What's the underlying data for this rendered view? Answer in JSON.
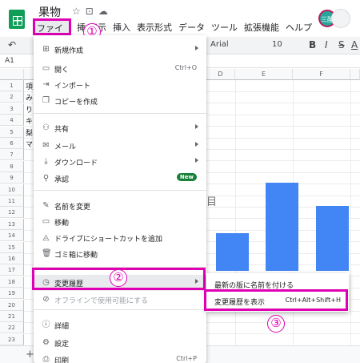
{
  "app": {
    "doc_title": "果物",
    "title_icons": [
      "star-icon",
      "move-folder-icon",
      "cloud-status-icon"
    ],
    "avatar_label": "三酸",
    "menubar": [
      "ファイル",
      "挿",
      "表示",
      "挿入",
      "表示形式",
      "データ",
      "ツール",
      "拡張機能",
      "ヘルプ"
    ]
  },
  "toolbar": {
    "font": "Arial",
    "size": "10",
    "bold": "B",
    "italic": "I",
    "strike": "S",
    "text_color": "A"
  },
  "formula": {
    "namebox": "A1"
  },
  "grid": {
    "columns": [
      "D",
      "E",
      "F"
    ],
    "rows": [
      "1",
      "2",
      "3",
      "4",
      "5",
      "6",
      "7",
      "8",
      "9",
      "10",
      "11",
      "12",
      "13",
      "14",
      "15",
      "16",
      "17",
      "18",
      "19",
      "20",
      "21",
      "22",
      "23"
    ],
    "cells_a": [
      "項",
      "み",
      "り",
      "キ",
      "梨",
      "マ"
    ],
    "chart_title_fragment": "目",
    "add_sheet": "+"
  },
  "chart_data": {
    "type": "bar",
    "categories": [
      "",
      "",
      ""
    ],
    "values": [
      42,
      98,
      72
    ],
    "ylim": [
      0,
      100
    ],
    "title": "",
    "xlabel": "",
    "ylabel": ""
  },
  "menu": {
    "items": [
      {
        "icon": "add-sheet-icon",
        "label": "新規作成",
        "arrow": true
      },
      {
        "icon": "folder-open-icon",
        "label": "開く",
        "shortcut": "Ctrl+O"
      },
      {
        "icon": "import-icon",
        "label": "インポート"
      },
      {
        "icon": "copy-icon",
        "label": "コピーを作成"
      },
      {
        "icon": "share-icon",
        "label": "共有",
        "arrow": true
      },
      {
        "icon": "email-icon",
        "label": "メール",
        "arrow": true
      },
      {
        "icon": "download-icon",
        "label": "ダウンロード",
        "arrow": true
      },
      {
        "icon": "approval-icon",
        "label": "承認",
        "badge": "New"
      },
      {
        "icon": "rename-icon",
        "label": "名前を変更"
      },
      {
        "icon": "move-icon",
        "label": "移動"
      },
      {
        "icon": "drive-shortcut-icon",
        "label": "ドライブにショートカットを追加"
      },
      {
        "icon": "trash-icon",
        "label": "ゴミ箱に移動"
      },
      {
        "icon": "history-icon",
        "label": "変更履歴",
        "arrow": true
      },
      {
        "icon": "offline-icon",
        "label": "オフラインで使用可能にする"
      },
      {
        "icon": "info-icon",
        "label": "詳細"
      },
      {
        "icon": "settings-icon",
        "label": "設定"
      },
      {
        "icon": "print-icon",
        "label": "印刷",
        "shortcut": "Ctrl+P"
      }
    ]
  },
  "submenu": {
    "items": [
      {
        "label": "最新の版に名前を付ける"
      },
      {
        "label": "変更履歴を表示",
        "shortcut": "Ctrl+Alt+Shift+H"
      }
    ]
  },
  "annotations": {
    "one": "①",
    "two": "②",
    "three": "③"
  },
  "colors": {
    "highlight": "#e000b4",
    "bar": "#4285f4",
    "new_badge": "#188038"
  }
}
